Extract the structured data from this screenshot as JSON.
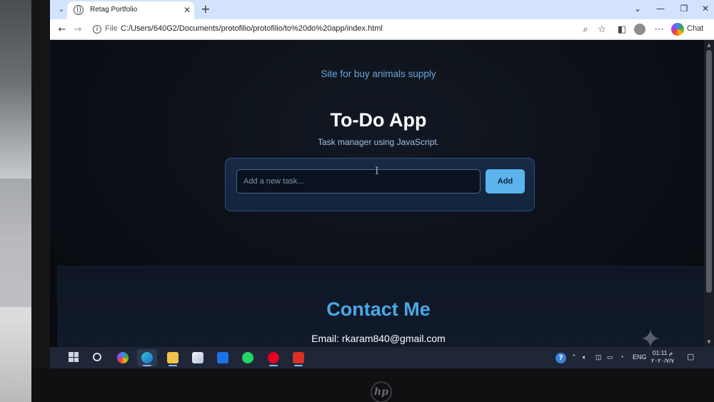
{
  "browser": {
    "tab_title": "Retag Portfolio",
    "url_scheme": "File",
    "url": "C:/Users/640G2/Documents/protofilio/protofilio/to%20do%20app/index.html",
    "chat_label": "Chat"
  },
  "page": {
    "subtitle_link": "Site for buy animals supply",
    "app_title": "To-Do App",
    "app_description": "Task manager using JavaScript.",
    "task_input_placeholder": "Add a new task...",
    "add_button_label": "Add",
    "contact_title": "Contact Me",
    "contact_email": "Email: rkaram840@gmail.com"
  },
  "taskbar": {
    "language": "ENG",
    "time": "01:11 م",
    "date": "٢٠٢٠/٧/٧"
  },
  "colors": {
    "accent": "#4aa8e6",
    "button": "#5bb4ec",
    "card": "#172a45"
  },
  "icons": [
    "globe-icon",
    "close-icon",
    "plus-icon",
    "back-arrow-icon",
    "forward-arrow-icon",
    "info-icon",
    "zoom-icon",
    "star-icon",
    "sidebar-icon",
    "profile-icon",
    "more-icon",
    "copilot-icon",
    "windows-start-icon",
    "search-icon",
    "edge-icon",
    "folder-icon",
    "store-icon",
    "mail-icon",
    "whatsapp-icon",
    "pinterest-icon",
    "help-icon",
    "speaker-icon",
    "battery-icon",
    "wifi-icon",
    "notification-icon",
    "hp-logo-icon"
  ]
}
